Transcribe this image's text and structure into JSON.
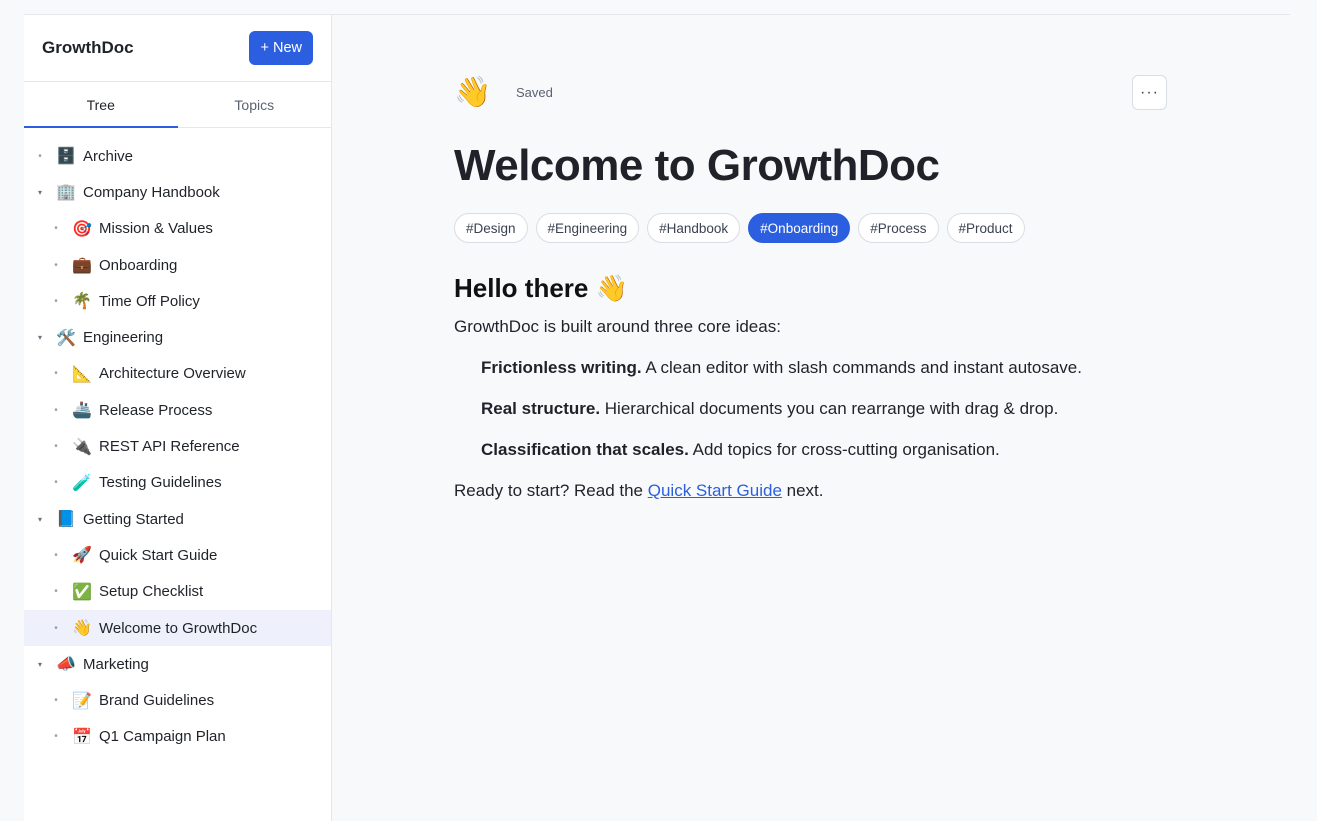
{
  "app": {
    "title": "GrowthDoc",
    "new_label": "+ New"
  },
  "tabs": [
    {
      "label": "Tree",
      "active": true
    },
    {
      "label": "Topics",
      "active": false
    }
  ],
  "tree": [
    {
      "label": "Archive",
      "icon": "🗄️",
      "level": 0,
      "caret": "•"
    },
    {
      "label": "Company Handbook",
      "icon": "🏢",
      "level": 0,
      "caret": "▾"
    },
    {
      "label": "Mission & Values",
      "icon": "🎯",
      "level": 1,
      "caret": "•"
    },
    {
      "label": "Onboarding",
      "icon": "💼",
      "level": 1,
      "caret": "•"
    },
    {
      "label": "Time Off Policy",
      "icon": "🌴",
      "level": 1,
      "caret": "•"
    },
    {
      "label": "Engineering",
      "icon": "🛠️",
      "level": 0,
      "caret": "▾"
    },
    {
      "label": "Architecture Overview",
      "icon": "📐",
      "level": 1,
      "caret": "•"
    },
    {
      "label": "Release Process",
      "icon": "🚢",
      "level": 1,
      "caret": "•"
    },
    {
      "label": "REST API Reference",
      "icon": "🔌",
      "level": 1,
      "caret": "•"
    },
    {
      "label": "Testing Guidelines",
      "icon": "🧪",
      "level": 1,
      "caret": "•"
    },
    {
      "label": "Getting Started",
      "icon": "📘",
      "level": 0,
      "caret": "▾"
    },
    {
      "label": "Quick Start Guide",
      "icon": "🚀",
      "level": 1,
      "caret": "•"
    },
    {
      "label": "Setup Checklist",
      "icon": "✅",
      "level": 1,
      "caret": "•"
    },
    {
      "label": "Welcome to GrowthDoc",
      "icon": "👋",
      "level": 1,
      "caret": "•",
      "selected": true
    },
    {
      "label": "Marketing",
      "icon": "📣",
      "level": 0,
      "caret": "▾"
    },
    {
      "label": "Brand Guidelines",
      "icon": "📝",
      "level": 1,
      "caret": "•"
    },
    {
      "label": "Q1 Campaign Plan",
      "icon": "📅",
      "level": 1,
      "caret": "•"
    }
  ],
  "doc": {
    "emoji": "👋",
    "status": "Saved",
    "more_label": "···",
    "title": "Welcome to GrowthDoc",
    "tags": [
      {
        "label": "#Design",
        "active": false
      },
      {
        "label": "#Engineering",
        "active": false
      },
      {
        "label": "#Handbook",
        "active": false
      },
      {
        "label": "#Onboarding",
        "active": true
      },
      {
        "label": "#Process",
        "active": false
      },
      {
        "label": "#Product",
        "active": false
      }
    ],
    "heading": "Hello there 👋",
    "intro": "GrowthDoc is built around three core ideas:",
    "ideas": [
      {
        "bold": "Frictionless writing.",
        "text": " A clean editor with slash commands and instant autosave."
      },
      {
        "bold": "Real structure.",
        "text": " Hierarchical documents you can rearrange with drag & drop."
      },
      {
        "bold": "Classification that scales.",
        "text": " Add topics for cross-cutting organisation."
      }
    ],
    "outro_before": "Ready to start? Read the ",
    "outro_link": "Quick Start Guide",
    "outro_after": " next."
  },
  "colors": {
    "accent": "#2b5fe0",
    "selected_bg": "#eef1fb",
    "border": "#e4e7ec"
  }
}
